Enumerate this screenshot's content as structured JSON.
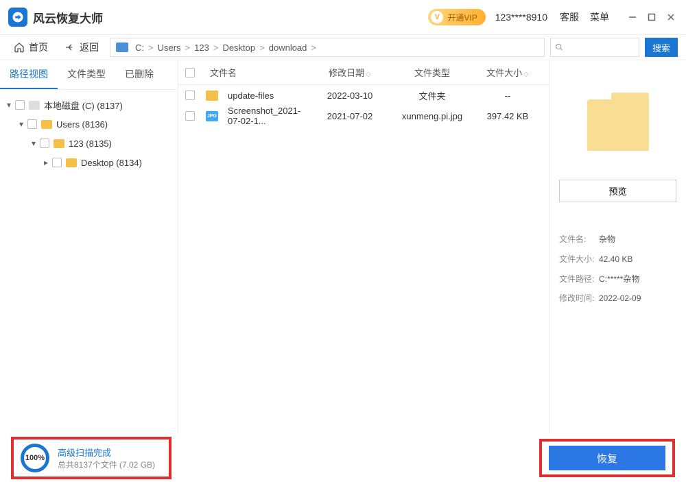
{
  "app": {
    "title": "风云恢复大师"
  },
  "titlebar": {
    "vip_label": "开通VIP",
    "user": "123****8910",
    "support": "客服",
    "menu": "菜单"
  },
  "toolbar": {
    "home": "首页",
    "back": "返回",
    "search_btn": "搜索"
  },
  "breadcrumb": [
    "C:",
    "Users",
    "123",
    "Desktop",
    "download"
  ],
  "tabs": {
    "path": "路径视图",
    "type": "文件类型",
    "deleted": "已删除"
  },
  "tree": [
    {
      "indent": 0,
      "caret": "▾",
      "icon": "disk",
      "label": "本地磁盘 (C) (8137)"
    },
    {
      "indent": 1,
      "caret": "▾",
      "icon": "folder",
      "label": "Users (8136)"
    },
    {
      "indent": 2,
      "caret": "▾",
      "icon": "folder",
      "label": "123 (8135)"
    },
    {
      "indent": 3,
      "caret": "▸",
      "icon": "folder",
      "label": "Desktop (8134)"
    }
  ],
  "grid": {
    "headers": {
      "name": "文件名",
      "date": "修改日期",
      "type": "文件类型",
      "size": "文件大小"
    },
    "rows": [
      {
        "icon": "folder",
        "name": "update-files",
        "date": "2022-03-10",
        "type": "文件夹",
        "size": "--"
      },
      {
        "icon": "jpg",
        "name": "Screenshot_2021-07-02-1...",
        "date": "2021-07-02",
        "type": "xunmeng.pi.jpg",
        "size": "397.42  KB"
      }
    ]
  },
  "preview": {
    "btn": "预览",
    "meta": {
      "name_k": "文件名:",
      "name_v": "杂物",
      "size_k": "文件大小:",
      "size_v": "42.40 KB",
      "path_k": "文件路径:",
      "path_v": "C:*****杂物",
      "date_k": "修改时间:",
      "date_v": "2022-02-09"
    }
  },
  "footer": {
    "percent": "100%",
    "status": "高级扫描完成",
    "summary": "总共8137个文件 (7.02 GB)",
    "recover": "恢复"
  }
}
